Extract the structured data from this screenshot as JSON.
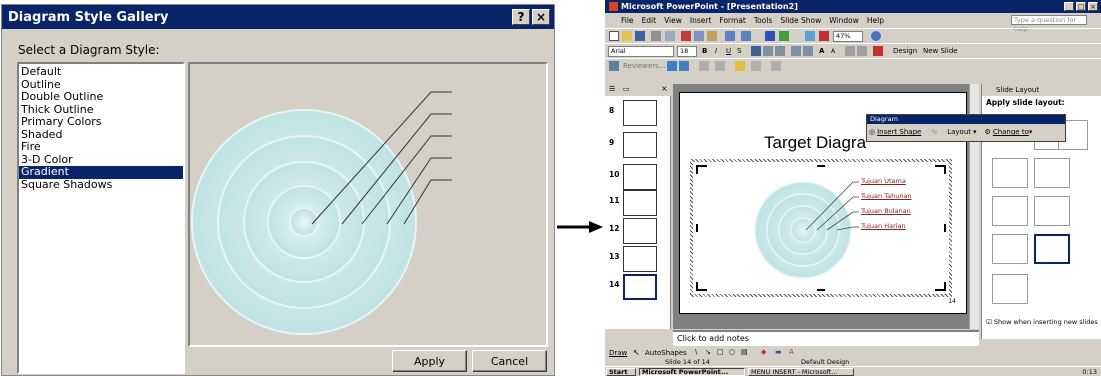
{
  "dialog": {
    "title": "Diagram Style Gallery",
    "help_btn": "?",
    "close_btn": "×",
    "prompt": "Select a Diagram Style:",
    "styles": [
      "Default",
      "Outline",
      "Double Outline",
      "Thick Outline",
      "Primary Colors",
      "Shaded",
      "Fire",
      "3-D Color",
      "Gradient",
      "Square Shadows"
    ],
    "selected_style": "Gradient",
    "apply_label": "Apply",
    "cancel_label": "Cancel"
  },
  "ppt": {
    "title": "Microsoft PowerPoint - [Presentation2]",
    "menu": [
      "File",
      "Edit",
      "View",
      "Insert",
      "Format",
      "Tools",
      "Slide Show",
      "Window",
      "Help"
    ],
    "question_placeholder": "Type a question for help",
    "zoom": "47%",
    "font_name": "Arial",
    "font_size": "18",
    "design_label": "Design",
    "new_slide_label": "New Slide",
    "reviewer_label": "Reviewers...",
    "slide_numbers": [
      "8",
      "9",
      "10",
      "11",
      "12",
      "13",
      "14"
    ],
    "slide_title": "Target Diagra",
    "diagram_labels": [
      "Tujuan Utama",
      "Tujuan Tahunan",
      "Tujuan Bulanan",
      "Tujuan Harian"
    ],
    "slide_page_number": "14",
    "notes_placeholder": "Click to add notes",
    "taskpane_title": "Slide Layout",
    "taskpane_subtitle": "Apply slide layout:",
    "show_when_inserting": "Show when inserting new slides",
    "draw_label": "Draw",
    "autoshapes_label": "AutoShapes",
    "status_slide": "Slide 14 of 14",
    "status_design": "Default Design",
    "start_label": "Start",
    "taskbar_items": [
      "Microsoft PowerPoint...",
      "MENU INSERT - Microsoft..."
    ],
    "clock": "0:13"
  },
  "diagram_toolbar": {
    "title": "Diagram",
    "insert_shape": "Insert Shape",
    "layout": "Layout",
    "change_to": "Change to"
  },
  "colors": {
    "titlebar": "#0a246a",
    "dialog_bg": "#d4d0c8",
    "ring_fill": "#cfe9ea",
    "ring_stroke": "#e8f6f6"
  }
}
